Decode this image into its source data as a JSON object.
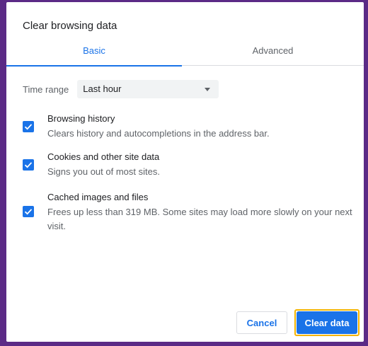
{
  "dialog": {
    "title": "Clear browsing data",
    "tabs": [
      {
        "label": "Basic",
        "active": true
      },
      {
        "label": "Advanced",
        "active": false
      }
    ]
  },
  "time_range": {
    "label": "Time range",
    "selected": "Last hour"
  },
  "options": [
    {
      "title": "Browsing history",
      "description": "Clears history and autocompletions in the address bar.",
      "checked": true
    },
    {
      "title": "Cookies and other site data",
      "description": "Signs you out of most sites.",
      "checked": true
    },
    {
      "title": "Cached images and files",
      "description": "Frees up less than 319 MB. Some sites may load more slowly on your next visit.",
      "checked": true
    }
  ],
  "buttons": {
    "cancel_label": "Cancel",
    "clear_label": "Clear data"
  },
  "colors": {
    "accent": "#1a73e8",
    "focus_ring": "#f4b400",
    "background": "#5b2a86"
  }
}
